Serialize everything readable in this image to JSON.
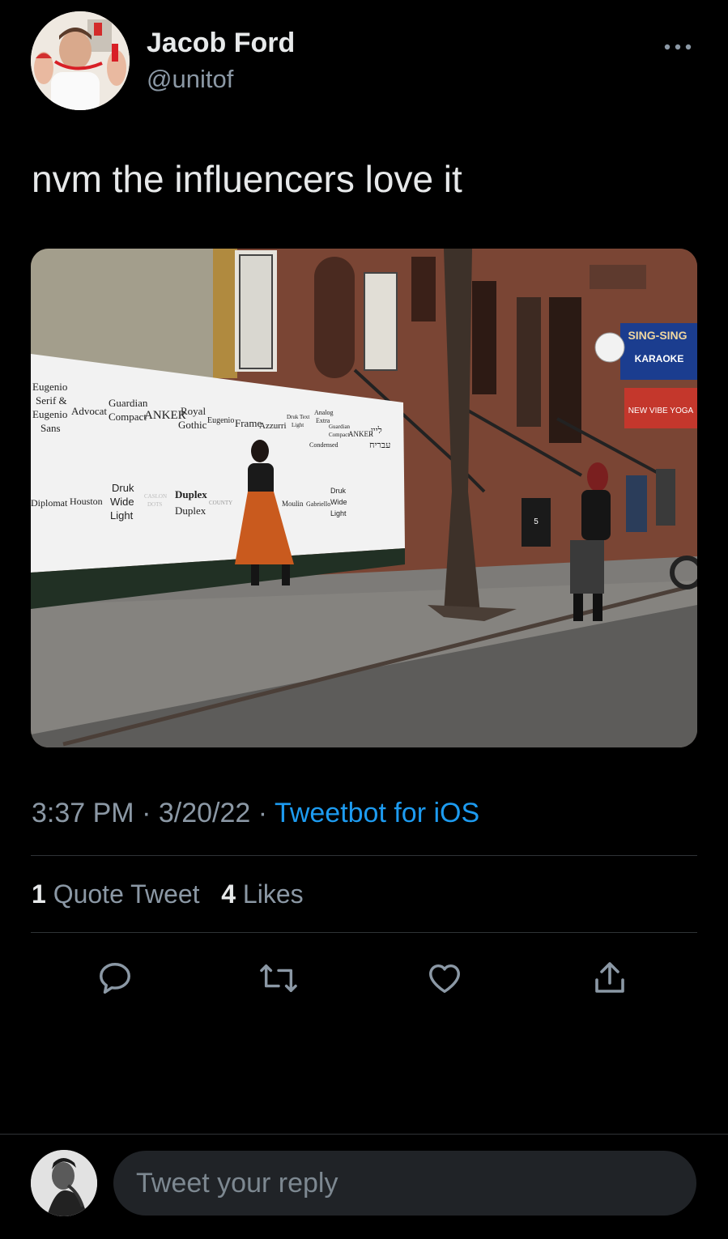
{
  "tweet": {
    "author_name": "Jacob Ford",
    "author_handle": "@unitof",
    "more_icon": "more-dots-icon",
    "text": "nvm the influencers love it",
    "time": "3:37 PM",
    "date": "3/20/22",
    "separator": "·",
    "source": "Tweetbot for iOS"
  },
  "stats": {
    "quote_count": "1",
    "quote_label": "Quote Tweet",
    "like_count": "4",
    "like_label": "Likes"
  },
  "actions": {
    "reply_icon": "reply-icon",
    "retweet_icon": "retweet-icon",
    "like_icon": "heart-icon",
    "share_icon": "share-icon"
  },
  "photo": {
    "wall_posters": [
      "Eugenio",
      "Serif &",
      "Eugenio",
      "Sans",
      "Advocat",
      "Guardian",
      "Compact",
      "ANKER",
      "Royal",
      "Gothic",
      "Eugenio",
      "Frame",
      "Azzurri",
      "Druk Text",
      "Light",
      "Analog",
      "Extra",
      "Condensed",
      "Guardian",
      "Compact",
      "ANKER",
      "ליין",
      "עבריח",
      "Diplomat",
      "Houston",
      "Druk",
      "Wide",
      "Light",
      "CASLON",
      "DOTS",
      "Duplex",
      "Duplex",
      "COUNTY",
      "Moulin",
      "Gabriello",
      "Druk",
      "Wide",
      "Light"
    ],
    "signs": [
      "SING-SING",
      "KARAOKE",
      "NEW VIBE YOGA",
      "5"
    ]
  },
  "reply": {
    "placeholder": "Tweet your reply"
  },
  "colors": {
    "background": "#000000",
    "accent": "#1d9bf0",
    "secondary_text": "#8b98a5",
    "divider": "#2f3336"
  }
}
